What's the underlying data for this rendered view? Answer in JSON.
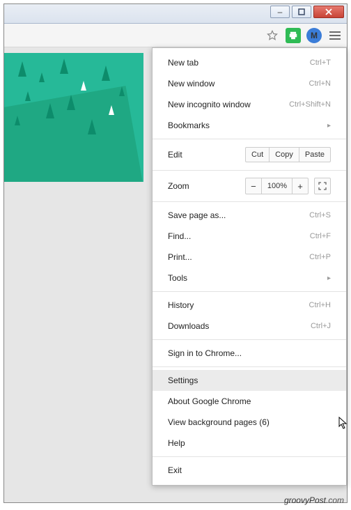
{
  "window": {
    "minimize_glyph": "–",
    "maximize_glyph": "▢",
    "close_glyph": "X"
  },
  "toolbar": {
    "star_icon": "star-icon",
    "print_ext": "print-friendly-icon",
    "m_ext_label": "M",
    "menu_icon": "hamburger-icon"
  },
  "menu": {
    "new_tab": {
      "label": "New tab",
      "shortcut": "Ctrl+T"
    },
    "new_window": {
      "label": "New window",
      "shortcut": "Ctrl+N"
    },
    "new_incognito": {
      "label": "New incognito window",
      "shortcut": "Ctrl+Shift+N"
    },
    "bookmarks": {
      "label": "Bookmarks"
    },
    "edit": {
      "label": "Edit",
      "cut": "Cut",
      "copy": "Copy",
      "paste": "Paste"
    },
    "zoom": {
      "label": "Zoom",
      "minus": "−",
      "pct": "100%",
      "plus": "+"
    },
    "save_as": {
      "label": "Save page as...",
      "shortcut": "Ctrl+S"
    },
    "find": {
      "label": "Find...",
      "shortcut": "Ctrl+F"
    },
    "print": {
      "label": "Print...",
      "shortcut": "Ctrl+P"
    },
    "tools": {
      "label": "Tools"
    },
    "history": {
      "label": "History",
      "shortcut": "Ctrl+H"
    },
    "downloads": {
      "label": "Downloads",
      "shortcut": "Ctrl+J"
    },
    "sign_in": {
      "label": "Sign in to Chrome..."
    },
    "settings": {
      "label": "Settings"
    },
    "about": {
      "label": "About Google Chrome"
    },
    "bg_pages": {
      "label": "View background pages (6)"
    },
    "help": {
      "label": "Help"
    },
    "exit": {
      "label": "Exit"
    }
  },
  "watermark": {
    "text": "groovyPost",
    "suffix": ".com"
  }
}
